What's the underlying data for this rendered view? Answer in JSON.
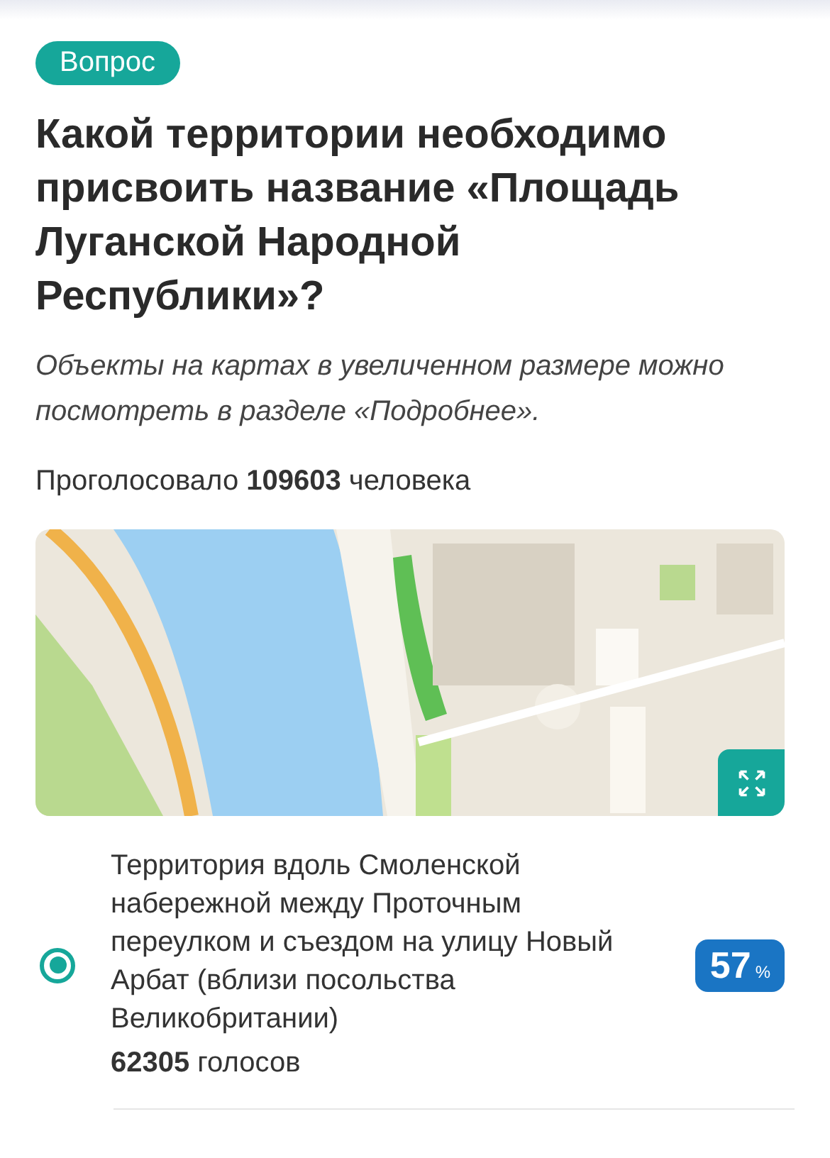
{
  "badge": "Вопрос",
  "question": "Какой территории необходимо присвоить название «Площадь Луганской Народной Республики»?",
  "note": "Объекты на картах в увеличенном размере можно посмотреть в разделе «Подробнее».",
  "votes_total": "Проголосовало **109603** человека",
  "options": [
    {
      "label": "Территория вдоль Смоленской набережной между Проточным переулком и съездом на улицу Новый Арбат (вблизи посольства Великобритании)",
      "votes": "**62305** голосов",
      "percent": "57",
      "percent_unit": "%",
      "selected": true
    }
  ]
}
